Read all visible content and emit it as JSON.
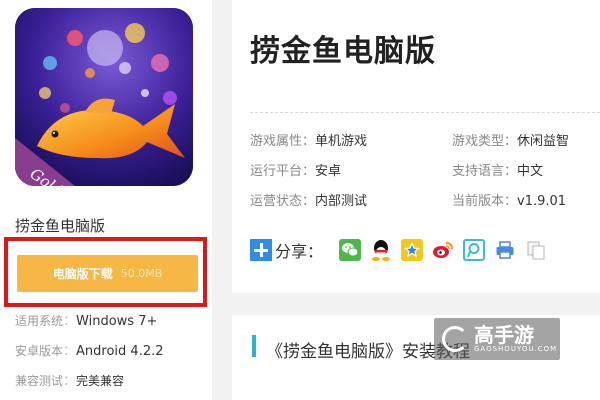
{
  "app": {
    "icon_caption": "Goldfish",
    "name": "捞金鱼电脑版",
    "download": {
      "label": "电脑版下载",
      "size": "50.0MB"
    },
    "info": [
      {
        "key": "适用系统",
        "sep": "：",
        "value": "Windows 7+"
      },
      {
        "key": "安卓版本",
        "sep": "：",
        "value": "Android 4.2.2"
      },
      {
        "key": "兼容测试",
        "sep": "：",
        "value": "完美兼容"
      }
    ]
  },
  "detail": {
    "title": "捞金鱼电脑版",
    "attributes": [
      {
        "key": "游戏属性：",
        "value": "单机游戏"
      },
      {
        "key": "游戏类型：",
        "value": "休闲益智"
      },
      {
        "key": "运行平台：",
        "value": "安卓"
      },
      {
        "key": "支持语言：",
        "value": "中文"
      },
      {
        "key": "运营状态：",
        "value": "内部测试"
      },
      {
        "key": "当前版本：",
        "value": "v1.9.01"
      }
    ],
    "share": {
      "label": "分享：",
      "icons": [
        "wechat-icon",
        "qq-icon",
        "qzone-icon",
        "weibo-icon",
        "tencent-weibo-icon",
        "print-icon",
        "copy-icon"
      ]
    }
  },
  "tutorial": {
    "title": "《捞金鱼电脑版》安装教程"
  },
  "watermark": {
    "text": "高手游",
    "subtext": "GAOSHOUYOU.COM"
  },
  "colors": {
    "download_button": "#f6b744",
    "highlight_frame": "#e31515",
    "accent_bar": "#2bb3cf",
    "share_plus": "#2e8de8",
    "icon_bg": "#2a1a7c",
    "icon_ribbon": "#8a3d8e"
  }
}
